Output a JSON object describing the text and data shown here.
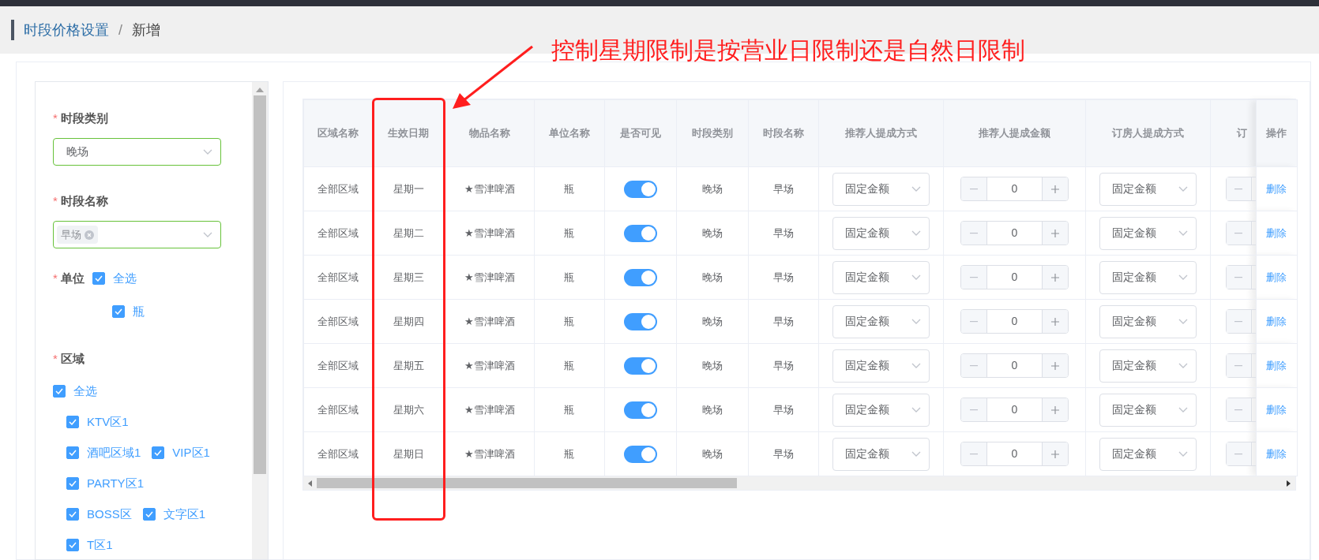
{
  "breadcrumb": [
    {
      "label": "时段价格设置",
      "kind": "link"
    },
    {
      "label": "/",
      "kind": "separator"
    },
    {
      "label": "新增",
      "kind": "current"
    }
  ],
  "annotation": {
    "text": "控制星期限制是按营业日限制还是自然日限制"
  },
  "form": {
    "period_type": {
      "required_mark": "*",
      "label": "时段类别",
      "value": "晚场"
    },
    "period_name": {
      "required_mark": "*",
      "label": "时段名称",
      "tags": [
        "早场"
      ]
    },
    "unit": {
      "required_mark": "*",
      "label": "单位",
      "all": {
        "label": "全选",
        "checked": true
      },
      "options": [
        {
          "label": "瓶",
          "checked": true
        }
      ]
    },
    "area": {
      "required_mark": "*",
      "label": "区域",
      "all": {
        "label": "全选",
        "checked": true
      },
      "option_rows": [
        [
          {
            "label": "KTV区1",
            "checked": true
          }
        ],
        [
          {
            "label": "酒吧区域1",
            "checked": true
          },
          {
            "label": "VIP区1",
            "checked": true
          }
        ],
        [
          {
            "label": "PARTY区1",
            "checked": true
          }
        ],
        [
          {
            "label": "BOSS区",
            "checked": true
          },
          {
            "label": "文字区1",
            "checked": true
          }
        ],
        [
          {
            "label": "T区1",
            "checked": true
          }
        ]
      ]
    }
  },
  "table": {
    "columns": [
      "区域名称",
      "生效日期",
      "物品名称",
      "单位名称",
      "是否可见",
      "时段类别",
      "时段名称",
      "推荐人提成方式",
      "推荐人提成金额",
      "订房人提成方式",
      "订",
      "操作"
    ],
    "rows": [
      {
        "area": "全部区域",
        "date": "星期一",
        "item": "★雪津啤酒",
        "unit": "瓶",
        "visible": true,
        "period_type": "晚场",
        "period_name": "早场",
        "referrer_method": "固定金额",
        "referrer_amount": "0",
        "booker_method": "固定金额",
        "action": "删除"
      },
      {
        "area": "全部区域",
        "date": "星期二",
        "item": "★雪津啤酒",
        "unit": "瓶",
        "visible": true,
        "period_type": "晚场",
        "period_name": "早场",
        "referrer_method": "固定金额",
        "referrer_amount": "0",
        "booker_method": "固定金额",
        "action": "删除"
      },
      {
        "area": "全部区域",
        "date": "星期三",
        "item": "★雪津啤酒",
        "unit": "瓶",
        "visible": true,
        "period_type": "晚场",
        "period_name": "早场",
        "referrer_method": "固定金额",
        "referrer_amount": "0",
        "booker_method": "固定金额",
        "action": "删除"
      },
      {
        "area": "全部区域",
        "date": "星期四",
        "item": "★雪津啤酒",
        "unit": "瓶",
        "visible": true,
        "period_type": "晚场",
        "period_name": "早场",
        "referrer_method": "固定金额",
        "referrer_amount": "0",
        "booker_method": "固定金额",
        "action": "删除"
      },
      {
        "area": "全部区域",
        "date": "星期五",
        "item": "★雪津啤酒",
        "unit": "瓶",
        "visible": true,
        "period_type": "晚场",
        "period_name": "早场",
        "referrer_method": "固定金额",
        "referrer_amount": "0",
        "booker_method": "固定金额",
        "action": "删除"
      },
      {
        "area": "全部区域",
        "date": "星期六",
        "item": "★雪津啤酒",
        "unit": "瓶",
        "visible": true,
        "period_type": "晚场",
        "period_name": "早场",
        "referrer_method": "固定金额",
        "referrer_amount": "0",
        "booker_method": "固定金额",
        "action": "删除"
      },
      {
        "area": "全部区域",
        "date": "星期日",
        "item": "★雪津啤酒",
        "unit": "瓶",
        "visible": true,
        "period_type": "晚场",
        "period_name": "早场",
        "referrer_method": "固定金额",
        "referrer_amount": "0",
        "booker_method": "固定金额",
        "action": "删除"
      }
    ]
  }
}
